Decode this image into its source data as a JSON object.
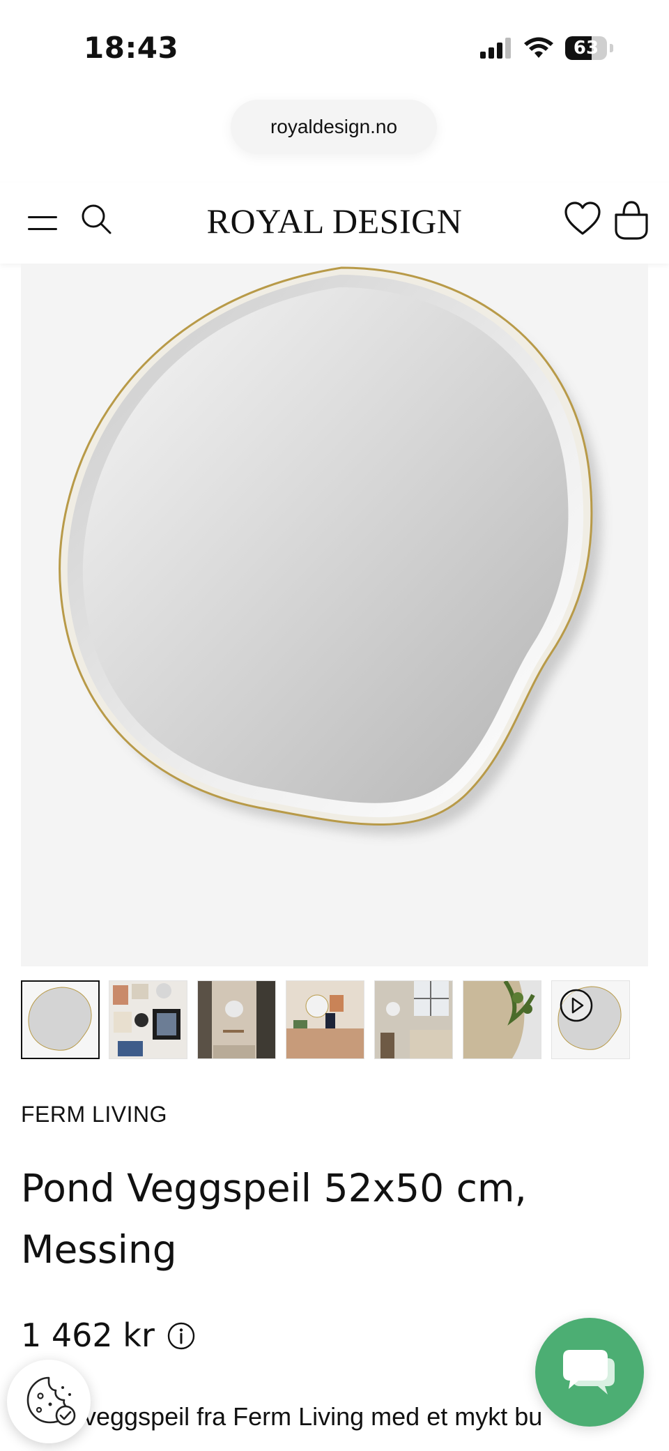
{
  "status_bar": {
    "time": "18:43",
    "battery_level": "63",
    "battery_fraction": 0.63
  },
  "browser": {
    "url": "royaldesign.no"
  },
  "header": {
    "logo": "ROYAL DESIGN",
    "icons": [
      "menu-icon",
      "search-icon",
      "heart-icon",
      "shopping-bag-icon"
    ]
  },
  "gallery": {
    "thumbnail_count": 7,
    "selected_index": 0,
    "video_icon": "play-icon"
  },
  "product": {
    "brand": "FERM LIVING",
    "title": "Pond Veggspeil 52x50 cm, Messing",
    "price": "1 462 kr",
    "description_visible": "veggspeil fra Ferm Living med et mykt bu"
  },
  "widgets": {
    "cookie_icon": "cookie-icon",
    "chat_icon": "chat-icon",
    "chat_color": "#4cae73"
  }
}
